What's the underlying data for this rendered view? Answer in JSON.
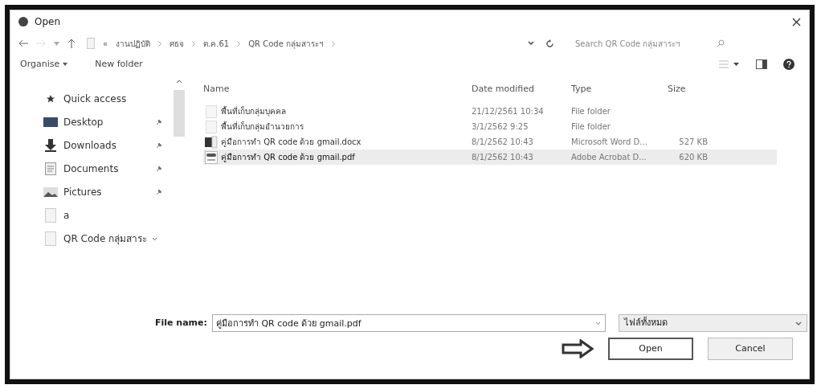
{
  "window": {
    "title": "Open"
  },
  "address_bar": {
    "crumbs": [
      "«",
      "งานปฏิบัติ",
      "ศธจ",
      "ต.ค.61",
      "QR Code กลุ่มสาระฯ"
    ]
  },
  "search": {
    "placeholder": "Search QR Code กลุ่มสาระฯ"
  },
  "toolbar": {
    "organise": "Organise",
    "new_folder": "New folder"
  },
  "sidebar": {
    "items": [
      {
        "label": "Quick access",
        "kind": "star",
        "pinned": false
      },
      {
        "label": "Desktop",
        "kind": "desktop",
        "pinned": true
      },
      {
        "label": "Downloads",
        "kind": "download",
        "pinned": true
      },
      {
        "label": "Documents",
        "kind": "documents",
        "pinned": true
      },
      {
        "label": "Pictures",
        "kind": "pictures",
        "pinned": true
      },
      {
        "label": "a",
        "kind": "folder",
        "pinned": false
      },
      {
        "label": "QR Code กลุ่มสาระ",
        "kind": "folder",
        "pinned": false
      }
    ]
  },
  "table": {
    "columns": [
      "Name",
      "Date modified",
      "Type",
      "Size"
    ],
    "rows": [
      {
        "name": "พื้นที่เก็บกลุ่มบุคคล",
        "date": "21/12/2561 10:34",
        "type": "File folder",
        "size": "",
        "kind": "folder",
        "selected": false
      },
      {
        "name": "พื้นที่เก็บกลุ่มอำนวยการ",
        "date": "3/1/2562 9:25",
        "type": "File folder",
        "size": "",
        "kind": "folder",
        "selected": false
      },
      {
        "name": "คู่มือการทำ QR code ด้วย gmail.docx",
        "date": "8/1/2562 10:43",
        "type": "Microsoft Word D...",
        "size": "527 KB",
        "kind": "word",
        "selected": false
      },
      {
        "name": "คู่มือการทำ QR code ด้วย gmail.pdf",
        "date": "8/1/2562 10:43",
        "type": "Adobe Acrobat D...",
        "size": "620 KB",
        "kind": "pdf",
        "selected": true
      }
    ]
  },
  "file_name": {
    "label": "File name:",
    "value": "คู่มือการทำ QR code ด้วย gmail.pdf"
  },
  "file_type": {
    "value": "ไฟล์ทั้งหมด"
  },
  "buttons": [
    {
      "label": "Open",
      "default": true
    },
    {
      "label": "Cancel",
      "default": false
    }
  ]
}
